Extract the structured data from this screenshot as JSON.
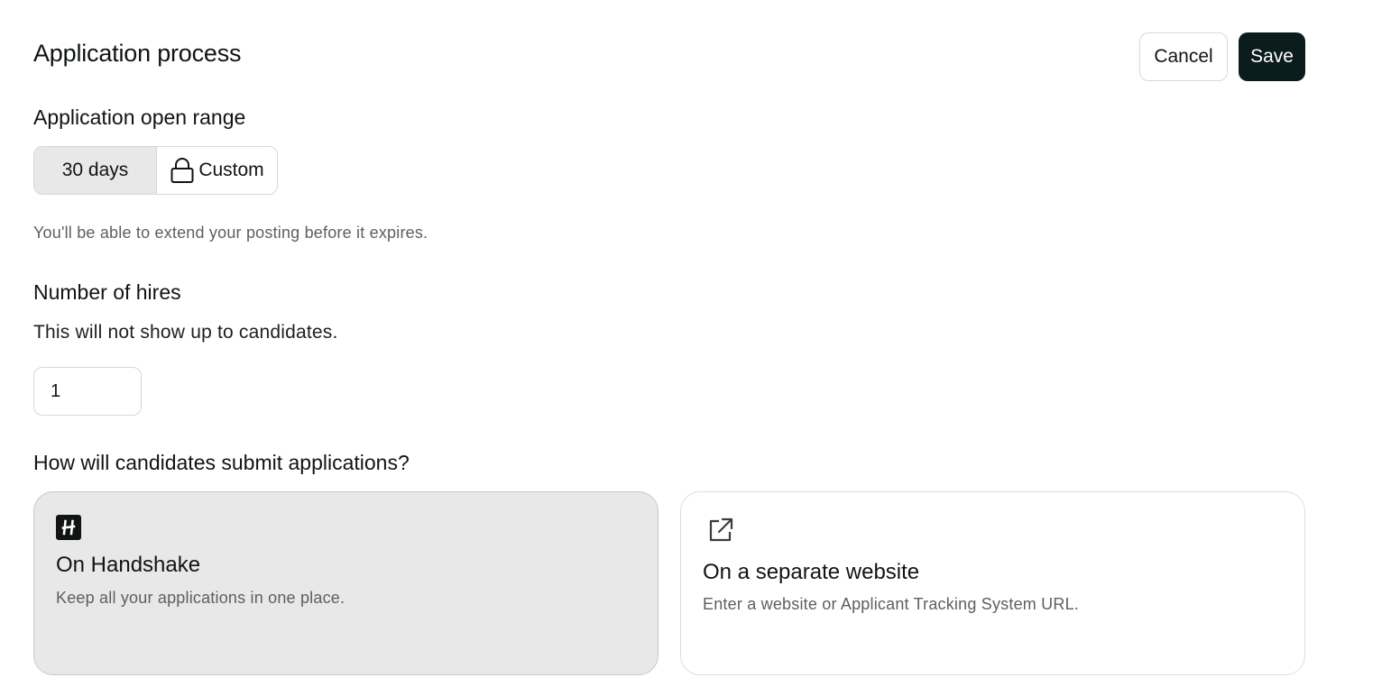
{
  "header": {
    "title": "Application process",
    "cancel_label": "Cancel",
    "save_label": "Save"
  },
  "open_range": {
    "title": "Application open range",
    "options": [
      {
        "label": "30 days",
        "selected": true
      },
      {
        "label": "Custom",
        "selected": false,
        "icon": "lock-icon"
      }
    ],
    "hint": "You'll be able to extend your posting before it expires."
  },
  "hires": {
    "title": "Number of hires",
    "subtitle": "This will not show up to candidates.",
    "value": "1"
  },
  "submission": {
    "title": "How will candidates submit applications?",
    "options": [
      {
        "title": "On Handshake",
        "description": "Keep all your applications in one place.",
        "icon": "handshake-logo-icon",
        "selected": true
      },
      {
        "title": "On a separate website",
        "description": "Enter a website or Applicant Tracking System URL.",
        "icon": "external-link-icon",
        "selected": false
      }
    ]
  },
  "colors": {
    "primary_dark": "#0b1c1d",
    "selected_bg": "#e8e8e8",
    "muted_text": "#5c5f60"
  }
}
